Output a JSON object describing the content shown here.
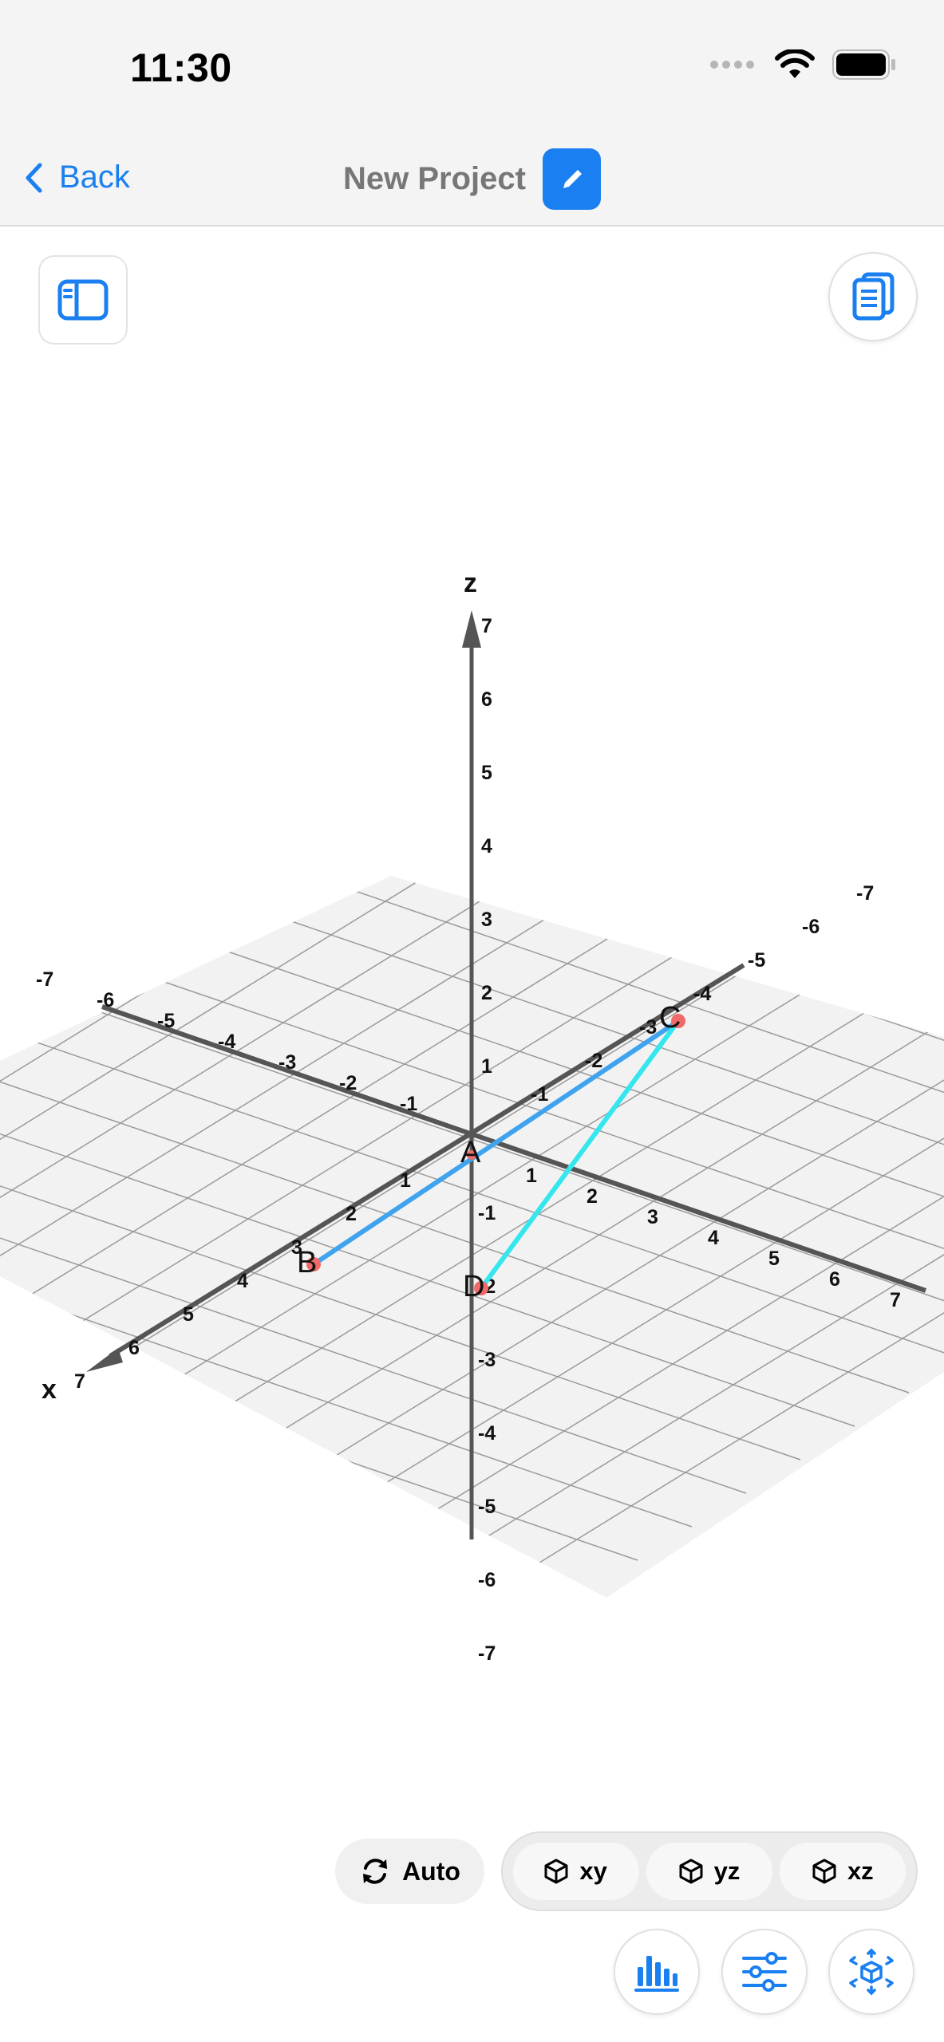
{
  "status": {
    "time": "11:30"
  },
  "nav": {
    "back_label": "Back",
    "title": "New Project"
  },
  "graph": {
    "axes": {
      "x": "x",
      "y": "",
      "z": "z"
    },
    "x_ticks_pos": [
      "1",
      "2",
      "3",
      "4",
      "5",
      "6",
      "7"
    ],
    "x_ticks_neg": [
      "-1",
      "-2",
      "-3",
      "-4",
      "-5",
      "-6",
      "-7"
    ],
    "y_ticks_pos": [
      "1",
      "2",
      "3",
      "4",
      "5",
      "6",
      "7"
    ],
    "y_ticks_neg": [
      "-1",
      "-2",
      "-3",
      "-4",
      "-5",
      "-6",
      "-7"
    ],
    "z_ticks_pos": [
      "1",
      "2",
      "3",
      "4",
      "5",
      "6",
      "7"
    ],
    "z_ticks_neg": [
      "-1",
      "-2",
      "-3",
      "-4",
      "-5",
      "-6",
      "-7"
    ],
    "points": [
      {
        "label": "A"
      },
      {
        "label": "B"
      },
      {
        "label": "C"
      },
      {
        "label": "D"
      }
    ],
    "segments": [
      {
        "from": "B",
        "to": "C",
        "color": "#3fa3ee"
      },
      {
        "from": "C",
        "to": "D",
        "color": "#34e6ee"
      }
    ],
    "point_color": "#f06a6a"
  },
  "controls": {
    "auto_label": "Auto",
    "plane_buttons": [
      "xy",
      "yz",
      "xz"
    ]
  },
  "colors": {
    "accent": "#1a7ff0"
  }
}
